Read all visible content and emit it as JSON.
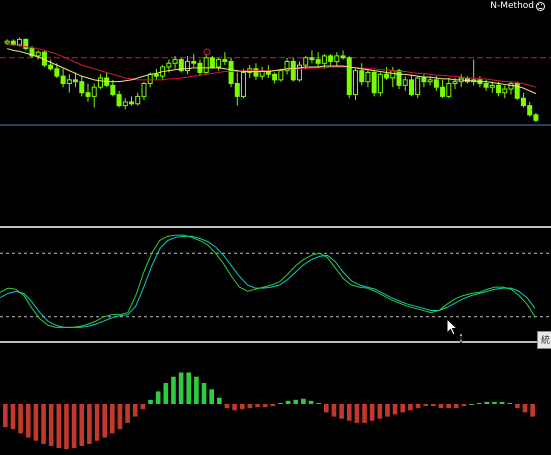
{
  "ea": {
    "name": "N-Method",
    "icon": "smiley-icon"
  },
  "tooltip": {
    "text": "統"
  },
  "cursor": {
    "icon": "move-cursor-icon"
  },
  "colors": {
    "background": "#000000",
    "bull_candle": "#7CFC00",
    "bear_candle": "#7CFC00",
    "ma_fast": "#F0E68C",
    "ma_slow": "#DC143C",
    "resistance_line": "#DC143C",
    "bid_line": "#4F7FB0",
    "stoch_main": "#32CD32",
    "stoch_signal": "#00CED1",
    "histogram_up": "#2ECC40",
    "histogram_down": "#C0392B",
    "level_line": "#C0C0C0"
  },
  "chart_data": [
    {
      "type": "candlestick",
      "title": "",
      "ylim": [
        0,
        100
      ],
      "candles": [
        [
          88,
          92,
          86,
          90
        ],
        [
          90,
          92,
          85,
          86
        ],
        [
          86,
          94,
          84,
          92
        ],
        [
          92,
          93,
          80,
          82
        ],
        [
          82,
          85,
          72,
          74
        ],
        [
          74,
          80,
          70,
          78
        ],
        [
          78,
          80,
          62,
          64
        ],
        [
          64,
          70,
          58,
          60
        ],
        [
          60,
          66,
          50,
          52
        ],
        [
          52,
          60,
          40,
          44
        ],
        [
          44,
          54,
          34,
          48
        ],
        [
          48,
          56,
          40,
          46
        ],
        [
          46,
          52,
          30,
          34
        ],
        [
          34,
          44,
          24,
          30
        ],
        [
          30,
          44,
          18,
          40
        ],
        [
          40,
          54,
          38,
          50
        ],
        [
          50,
          56,
          40,
          42
        ],
        [
          42,
          48,
          30,
          32
        ],
        [
          32,
          36,
          18,
          20
        ],
        [
          20,
          28,
          16,
          24
        ],
        [
          24,
          30,
          20,
          22
        ],
        [
          22,
          34,
          20,
          30
        ],
        [
          30,
          46,
          26,
          44
        ],
        [
          44,
          56,
          40,
          54
        ],
        [
          54,
          60,
          48,
          52
        ],
        [
          52,
          64,
          48,
          62
        ],
        [
          62,
          70,
          56,
          66
        ],
        [
          66,
          74,
          60,
          70
        ],
        [
          70,
          72,
          56,
          58
        ],
        [
          58,
          74,
          54,
          68
        ],
        [
          68,
          76,
          62,
          66
        ],
        [
          66,
          70,
          52,
          56
        ],
        [
          56,
          76,
          54,
          72
        ],
        [
          72,
          74,
          60,
          62
        ],
        [
          62,
          72,
          58,
          70
        ],
        [
          70,
          78,
          64,
          68
        ],
        [
          68,
          72,
          40,
          44
        ],
        [
          44,
          56,
          20,
          30
        ],
        [
          30,
          60,
          28,
          56
        ],
        [
          56,
          64,
          50,
          60
        ],
        [
          60,
          66,
          48,
          52
        ],
        [
          52,
          62,
          48,
          58
        ],
        [
          58,
          64,
          50,
          54
        ],
        [
          54,
          56,
          44,
          48
        ],
        [
          48,
          60,
          46,
          58
        ],
        [
          58,
          72,
          54,
          68
        ],
        [
          68,
          72,
          46,
          48
        ],
        [
          48,
          68,
          46,
          64
        ],
        [
          64,
          74,
          60,
          72
        ],
        [
          72,
          80,
          66,
          70
        ],
        [
          70,
          78,
          62,
          66
        ],
        [
          66,
          76,
          60,
          74
        ],
        [
          74,
          76,
          64,
          68
        ],
        [
          68,
          78,
          62,
          74
        ],
        [
          74,
          80,
          70,
          72
        ],
        [
          72,
          74,
          28,
          32
        ],
        [
          32,
          60,
          26,
          58
        ],
        [
          58,
          66,
          42,
          46
        ],
        [
          46,
          60,
          40,
          56
        ],
        [
          56,
          58,
          30,
          34
        ],
        [
          34,
          56,
          30,
          54
        ],
        [
          54,
          62,
          48,
          50
        ],
        [
          50,
          62,
          40,
          58
        ],
        [
          58,
          60,
          38,
          42
        ],
        [
          42,
          52,
          36,
          48
        ],
        [
          48,
          54,
          30,
          32
        ],
        [
          32,
          52,
          28,
          50
        ],
        [
          50,
          54,
          40,
          46
        ],
        [
          46,
          52,
          42,
          48
        ],
        [
          48,
          52,
          36,
          40
        ],
        [
          40,
          48,
          28,
          30
        ],
        [
          30,
          50,
          28,
          44
        ],
        [
          44,
          50,
          38,
          46
        ],
        [
          46,
          54,
          40,
          50
        ],
        [
          50,
          52,
          44,
          46
        ],
        [
          46,
          70,
          42,
          48
        ],
        [
          48,
          52,
          40,
          44
        ],
        [
          44,
          48,
          36,
          40
        ],
        [
          40,
          46,
          34,
          42
        ],
        [
          42,
          46,
          30,
          34
        ],
        [
          34,
          42,
          28,
          38
        ],
        [
          38,
          46,
          32,
          44
        ],
        [
          44,
          46,
          26,
          28
        ],
        [
          28,
          34,
          18,
          20
        ],
        [
          20,
          24,
          8,
          10
        ],
        [
          10,
          12,
          2,
          4
        ]
      ],
      "ma_fast": [
        82,
        80,
        79,
        77,
        75,
        73,
        70,
        67,
        64,
        61,
        58,
        55,
        52,
        50,
        48,
        47,
        46,
        46,
        46,
        47,
        48,
        50,
        52,
        54,
        55,
        57,
        58,
        59,
        60,
        60,
        61,
        61,
        61,
        61,
        61,
        60,
        59,
        58,
        57,
        57,
        57,
        57,
        57,
        58,
        59,
        60,
        60,
        61,
        62,
        62,
        62,
        63,
        63,
        63,
        63,
        62,
        61,
        60,
        59,
        58,
        57,
        56,
        55,
        54,
        54,
        53,
        52,
        51,
        51,
        50,
        49,
        49,
        48,
        48,
        47,
        47,
        46,
        46,
        45,
        44,
        43,
        42,
        41,
        39,
        36,
        33
      ],
      "ma_slow": [
        86,
        86,
        85,
        84,
        83,
        82,
        80,
        78,
        76,
        73,
        70,
        67,
        64,
        62,
        60,
        58,
        56,
        54,
        52,
        50,
        49,
        48,
        48,
        48,
        48,
        48,
        49,
        49,
        50,
        51,
        52,
        53,
        54,
        55,
        56,
        57,
        57,
        57,
        58,
        58,
        58,
        58,
        58,
        58,
        59,
        59,
        60,
        60,
        60,
        61,
        61,
        61,
        62,
        62,
        62,
        62,
        61,
        61,
        60,
        60,
        59,
        59,
        58,
        57,
        57,
        56,
        55,
        55,
        54,
        53,
        53,
        52,
        52,
        51,
        50,
        50,
        49,
        49,
        48,
        47,
        46,
        46,
        45,
        44,
        42,
        40
      ],
      "resistance_level": 72
    },
    {
      "type": "line",
      "title": "",
      "ylim": [
        0,
        100
      ],
      "levels": [
        80,
        20
      ],
      "series": [
        {
          "values": [
            43,
            47,
            46,
            40,
            28,
            18,
            12,
            10,
            10,
            10,
            11,
            13,
            16,
            20,
            22,
            22,
            24,
            40,
            62,
            80,
            92,
            96,
            97,
            97,
            95,
            92,
            88,
            80,
            70,
            58,
            48,
            44,
            46,
            48,
            50,
            53,
            60,
            68,
            74,
            78,
            80,
            76,
            66,
            56,
            50,
            48,
            47,
            44,
            40,
            36,
            33,
            30,
            28,
            26,
            24,
            26,
            32,
            37,
            40,
            42,
            43,
            46,
            48,
            48,
            46,
            40,
            32,
            20
          ]
        },
        {
          "values": [
            38,
            42,
            44,
            42,
            34,
            24,
            16,
            12,
            10,
            10,
            10,
            11,
            13,
            16,
            19,
            21,
            22,
            30,
            48,
            68,
            84,
            92,
            95,
            96,
            96,
            94,
            91,
            86,
            78,
            68,
            58,
            50,
            47,
            47,
            48,
            50,
            55,
            62,
            69,
            74,
            77,
            78,
            72,
            62,
            54,
            50,
            48,
            46,
            42,
            38,
            35,
            32,
            30,
            28,
            26,
            26,
            29,
            33,
            37,
            40,
            42,
            44,
            46,
            47,
            47,
            44,
            38,
            28
          ]
        }
      ]
    },
    {
      "type": "bar",
      "title": "",
      "ylim": [
        -45,
        32
      ],
      "values": [
        -22,
        -24,
        -28,
        -32,
        -35,
        -38,
        -40,
        -42,
        -43,
        -42,
        -40,
        -38,
        -35,
        -32,
        -28,
        -24,
        -18,
        -12,
        -5,
        4,
        12,
        20,
        26,
        30,
        30,
        26,
        20,
        14,
        6,
        -4,
        -6,
        -5,
        -4,
        -3,
        -3,
        -2,
        1,
        3,
        4,
        5,
        3,
        1,
        -8,
        -12,
        -14,
        -16,
        -18,
        -18,
        -16,
        -14,
        -12,
        -10,
        -8,
        -6,
        -4,
        -2,
        -2,
        -4,
        -4,
        -4,
        -2,
        0,
        1,
        2,
        2,
        2,
        1,
        -4,
        -8,
        -12
      ]
    }
  ]
}
